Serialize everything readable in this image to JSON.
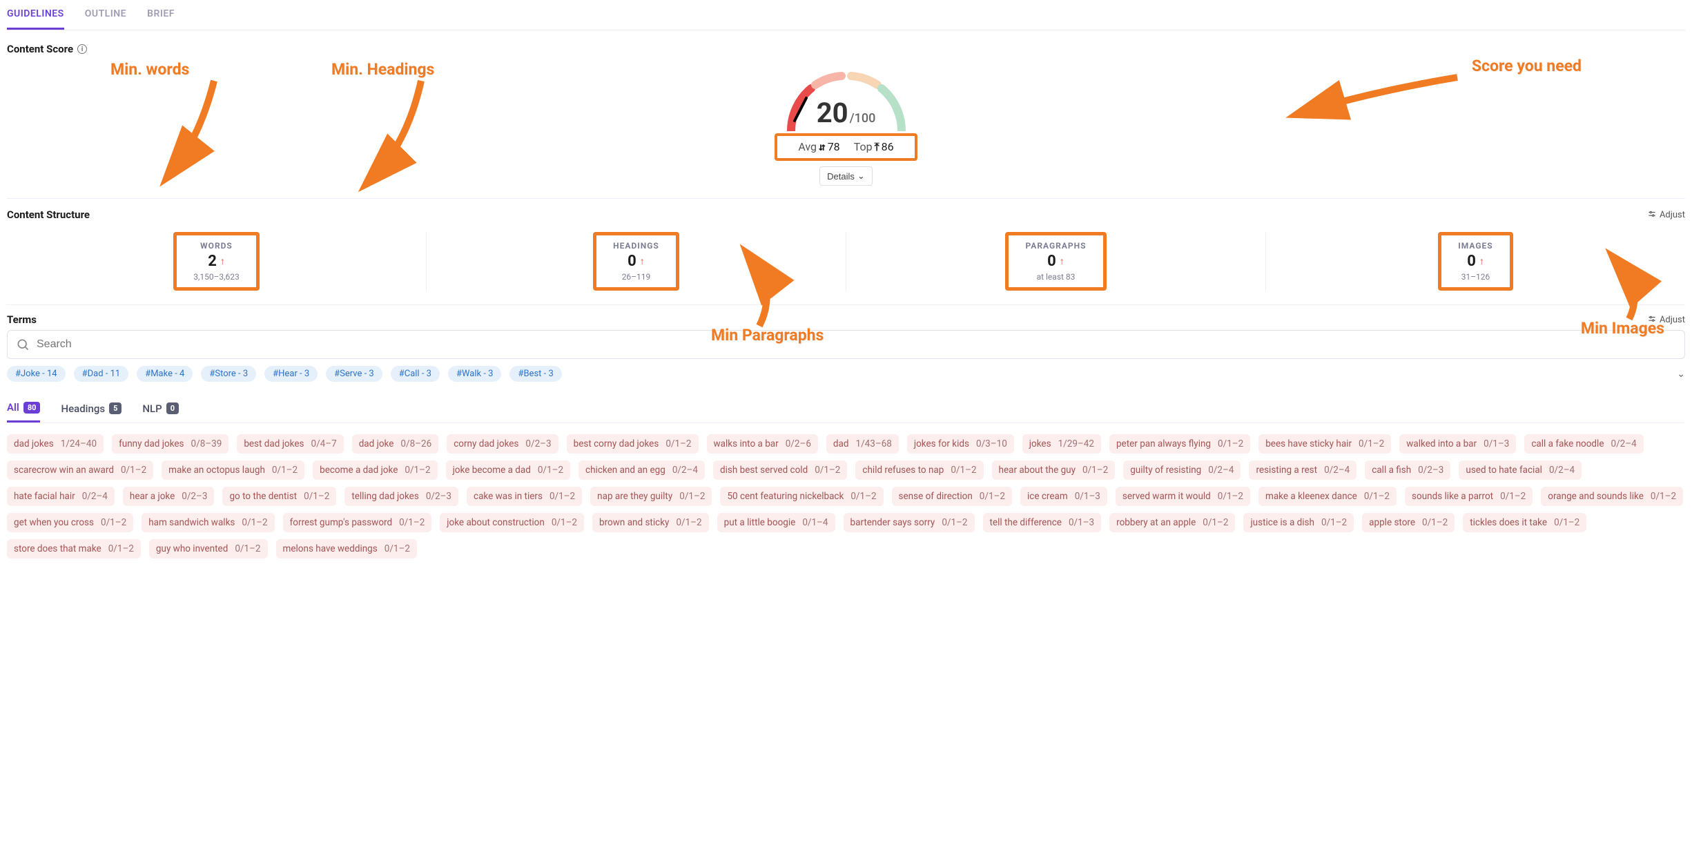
{
  "tabs": {
    "guidelines": "GUIDELINES",
    "outline": "OUTLINE",
    "brief": "BRIEF"
  },
  "content_score": {
    "title": "Content Score",
    "value": "20",
    "max": "/100",
    "avg_label": "Avg",
    "avg_value": "78",
    "top_label": "Top",
    "top_value": "86",
    "details": "Details"
  },
  "content_structure": {
    "title": "Content Structure",
    "adjust": "Adjust",
    "words": {
      "label": "WORDS",
      "value": "2",
      "range": "3,150–3,623"
    },
    "headings": {
      "label": "HEADINGS",
      "value": "0",
      "range": "26–119"
    },
    "paragraphs": {
      "label": "PARAGRAPHS",
      "value": "0",
      "range": "at least 83"
    },
    "images": {
      "label": "IMAGES",
      "value": "0",
      "range": "31–126"
    }
  },
  "terms": {
    "title": "Terms",
    "adjust": "Adjust",
    "search_placeholder": "Search",
    "hashtags": [
      "#Joke - 14",
      "#Dad - 11",
      "#Make - 4",
      "#Store - 3",
      "#Hear - 3",
      "#Serve - 3",
      "#Call - 3",
      "#Walk - 3",
      "#Best - 3"
    ],
    "subtabs": {
      "all": {
        "label": "All",
        "count": "80"
      },
      "headings": {
        "label": "Headings",
        "count": "5"
      },
      "nlp": {
        "label": "NLP",
        "count": "0"
      }
    },
    "chips": [
      {
        "t": "dad jokes",
        "c": "1/24–40"
      },
      {
        "t": "funny dad jokes",
        "c": "0/8–39"
      },
      {
        "t": "best dad jokes",
        "c": "0/4–7"
      },
      {
        "t": "dad joke",
        "c": "0/8–26"
      },
      {
        "t": "corny dad jokes",
        "c": "0/2–3"
      },
      {
        "t": "best corny dad jokes",
        "c": "0/1–2"
      },
      {
        "t": "walks into a bar",
        "c": "0/2–6"
      },
      {
        "t": "dad",
        "c": "1/43–68"
      },
      {
        "t": "jokes for kids",
        "c": "0/3–10"
      },
      {
        "t": "jokes",
        "c": "1/29–42"
      },
      {
        "t": "peter pan always flying",
        "c": "0/1–2"
      },
      {
        "t": "bees have sticky hair",
        "c": "0/1–2"
      },
      {
        "t": "walked into a bar",
        "c": "0/1–3"
      },
      {
        "t": "call a fake noodle",
        "c": "0/2–4"
      },
      {
        "t": "scarecrow win an award",
        "c": "0/1–2"
      },
      {
        "t": "make an octopus laugh",
        "c": "0/1–2"
      },
      {
        "t": "become a dad joke",
        "c": "0/1–2"
      },
      {
        "t": "joke become a dad",
        "c": "0/1–2"
      },
      {
        "t": "chicken and an egg",
        "c": "0/2–4"
      },
      {
        "t": "dish best served cold",
        "c": "0/1–2"
      },
      {
        "t": "child refuses to nap",
        "c": "0/1–2"
      },
      {
        "t": "hear about the guy",
        "c": "0/1–2"
      },
      {
        "t": "guilty of resisting",
        "c": "0/2–4"
      },
      {
        "t": "resisting a rest",
        "c": "0/2–4"
      },
      {
        "t": "call a fish",
        "c": "0/2–3"
      },
      {
        "t": "used to hate facial",
        "c": "0/2–4"
      },
      {
        "t": "hate facial hair",
        "c": "0/2–4"
      },
      {
        "t": "hear a joke",
        "c": "0/2–3"
      },
      {
        "t": "go to the dentist",
        "c": "0/1–2"
      },
      {
        "t": "telling dad jokes",
        "c": "0/2–3"
      },
      {
        "t": "cake was in tiers",
        "c": "0/1–2"
      },
      {
        "t": "nap are they guilty",
        "c": "0/1–2"
      },
      {
        "t": "50 cent featuring nickelback",
        "c": "0/1–2"
      },
      {
        "t": "sense of direction",
        "c": "0/1–2"
      },
      {
        "t": "ice cream",
        "c": "0/1–3"
      },
      {
        "t": "served warm it would",
        "c": "0/1–2"
      },
      {
        "t": "make a kleenex dance",
        "c": "0/1–2"
      },
      {
        "t": "sounds like a parrot",
        "c": "0/1–2"
      },
      {
        "t": "orange and sounds like",
        "c": "0/1–2"
      },
      {
        "t": "get when you cross",
        "c": "0/1–2"
      },
      {
        "t": "ham sandwich walks",
        "c": "0/1–2"
      },
      {
        "t": "forrest gump's password",
        "c": "0/1–2"
      },
      {
        "t": "joke about construction",
        "c": "0/1–2"
      },
      {
        "t": "brown and sticky",
        "c": "0/1–2"
      },
      {
        "t": "put a little boogie",
        "c": "0/1–4"
      },
      {
        "t": "bartender says sorry",
        "c": "0/1–2"
      },
      {
        "t": "tell the difference",
        "c": "0/1–3"
      },
      {
        "t": "robbery at an apple",
        "c": "0/1–2"
      },
      {
        "t": "justice is a dish",
        "c": "0/1–2"
      },
      {
        "t": "apple store",
        "c": "0/1–2"
      },
      {
        "t": "tickles does it take",
        "c": "0/1–2"
      },
      {
        "t": "store does that make",
        "c": "0/1–2"
      },
      {
        "t": "guy who invented",
        "c": "0/1–2"
      },
      {
        "t": "melons have weddings",
        "c": "0/1–2"
      }
    ]
  },
  "annotations": {
    "min_words": "Min. words",
    "min_headings": "Min. Headings",
    "score_need": "Score you need",
    "min_paragraphs": "Min Paragraphs",
    "min_images": "Min Images"
  }
}
